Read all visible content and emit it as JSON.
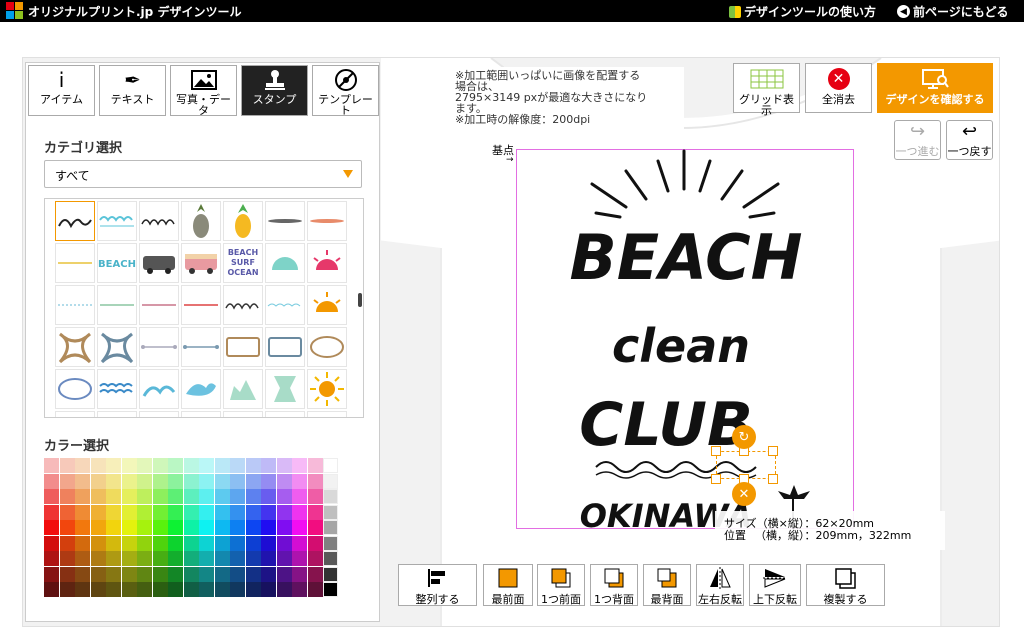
{
  "header": {
    "logo_text": "オリジナルプリント.jp デザインツール",
    "help_link": "デザインツールの使い方",
    "back_link": "前ページにもどる"
  },
  "tabs": [
    {
      "label": "アイテム",
      "icon": "info-icon"
    },
    {
      "label": "テキスト",
      "icon": "pen-icon"
    },
    {
      "label": "写真・データ",
      "icon": "image-icon"
    },
    {
      "label": "スタンプ",
      "icon": "stamp-icon"
    },
    {
      "label": "テンプレート",
      "icon": "template-icon"
    }
  ],
  "category": {
    "label": "カテゴリ選択",
    "selected": "すべて"
  },
  "color_section": {
    "label": "カラー選択"
  },
  "stamp_texts": {
    "beach_text": "BEACH",
    "surf_text": "BEACH\nSURF\nOCEAN"
  },
  "canvas": {
    "note_line1": "※加工範囲いっぱいに画像を配置する",
    "note_line2": "場合は、",
    "note_line3": "2795×3149 pxが最適な大きさになり",
    "note_line4": "ます。",
    "note_line5": "※加工時の解像度：200dpi",
    "origin_label": "基点",
    "design_words": [
      "BEACH",
      "clean",
      "CLUB",
      "OKINAWA"
    ]
  },
  "right_buttons": {
    "grid": "グリッド表示",
    "clear": "全消去",
    "confirm": "デザインを確認する",
    "redo": "一つ進む",
    "undo": "一つ戻す"
  },
  "info": {
    "size_line": "サイズ（横×縦）：62×20mm",
    "pos_line": "位置 　（横，縦）：209mm，322mm"
  },
  "toolbar": [
    {
      "label": "整列する",
      "icon": "align-icon"
    },
    {
      "label": "最前面",
      "icon": "bring-front-icon"
    },
    {
      "label": "1つ前面",
      "icon": "bring-forward-icon"
    },
    {
      "label": "1つ背面",
      "icon": "send-backward-icon"
    },
    {
      "label": "最背面",
      "icon": "send-back-icon"
    },
    {
      "label": "左右反転",
      "icon": "flip-horizontal-icon"
    },
    {
      "label": "上下反転",
      "icon": "flip-vertical-icon"
    },
    {
      "label": "複製する",
      "icon": "duplicate-icon"
    }
  ],
  "colors": {
    "accent": "#f39800",
    "header_bg": "#000000",
    "print_area_border": "#e26ee2",
    "clear_red": "#e60012"
  }
}
